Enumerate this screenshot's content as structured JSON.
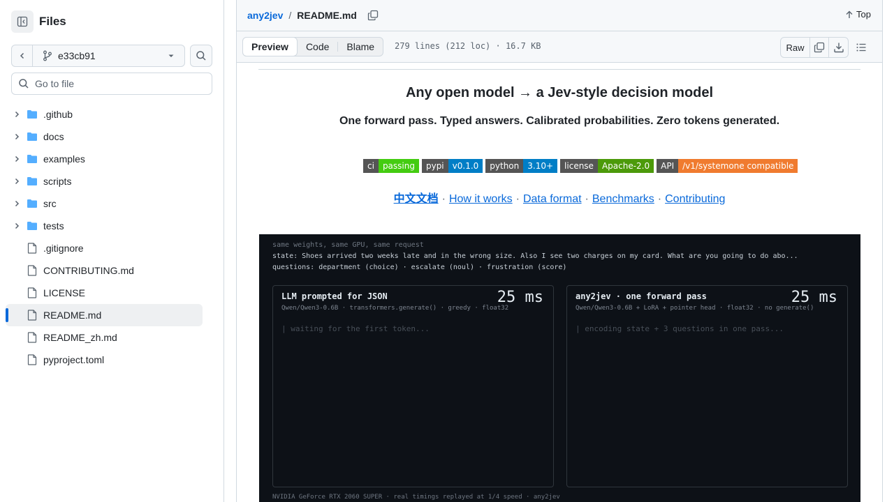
{
  "sidebar": {
    "title": "Files",
    "branch": "e33cb91",
    "search_placeholder": "Go to file",
    "tree": [
      {
        "type": "folder",
        "label": ".github"
      },
      {
        "type": "folder",
        "label": "docs"
      },
      {
        "type": "folder",
        "label": "examples"
      },
      {
        "type": "folder",
        "label": "scripts"
      },
      {
        "type": "folder",
        "label": "src"
      },
      {
        "type": "folder",
        "label": "tests"
      },
      {
        "type": "file",
        "label": ".gitignore"
      },
      {
        "type": "file",
        "label": "CONTRIBUTING.md"
      },
      {
        "type": "file",
        "label": "LICENSE"
      },
      {
        "type": "file",
        "label": "README.md",
        "active": true
      },
      {
        "type": "file",
        "label": "README_zh.md"
      },
      {
        "type": "file",
        "label": "pyproject.toml"
      }
    ]
  },
  "breadcrumb": {
    "repo": "any2jev",
    "separator": "/",
    "file": "README.md",
    "top_label": "Top"
  },
  "toolbar": {
    "tabs": [
      "Preview",
      "Code",
      "Blame"
    ],
    "active_tab": "Preview",
    "file_meta": "279 lines (212 loc) · 16.7 KB",
    "raw_label": "Raw"
  },
  "readme": {
    "title": "Any open model  →  a Jev-style decision model",
    "subtitle": "One forward pass. Typed answers. Calibrated probabilities. Zero tokens generated.",
    "badges": [
      {
        "left": "ci",
        "right": "passing",
        "color": "#44cc11"
      },
      {
        "left": "pypi",
        "right": "v0.1.0",
        "color": "#007ec6"
      },
      {
        "left": "python",
        "right": "3.10+",
        "color": "#007ec6"
      },
      {
        "left": "license",
        "right": "Apache-2.0",
        "color": "#4c9a0a"
      },
      {
        "left": "API",
        "right": "/v1/systemone compatible",
        "color": "#f07b2f"
      }
    ],
    "links": {
      "zh": "中文文档",
      "how": "How it works",
      "data": "Data format",
      "bench": "Benchmarks",
      "contrib": "Contributing",
      "sep": "·"
    },
    "demo": {
      "line1": "same weights, same GPU, same request",
      "line2": "state:  Shoes arrived two weeks late and in the wrong size. Also I see two charges on my card. What are you going to do abo...",
      "line3": "questions:  department (choice) · escalate (noul) · frustration (score)",
      "left": {
        "title": "LLM prompted for JSON",
        "sub": "Qwen/Qwen3-0.6B · transformers.generate() · greedy · float32",
        "ms": "25 ms",
        "status": "| waiting for the first token..."
      },
      "right": {
        "title": "any2jev · one forward pass",
        "sub": "Qwen/Qwen3-0.6B + LoRA + pointer head · float32 · no generate()",
        "ms": "25 ms",
        "status": "| encoding state + 3 questions in one pass..."
      },
      "footer": "NVIDIA GeForce RTX 2060 SUPER · real timings replayed at 1/4 speed · any2jev"
    }
  }
}
